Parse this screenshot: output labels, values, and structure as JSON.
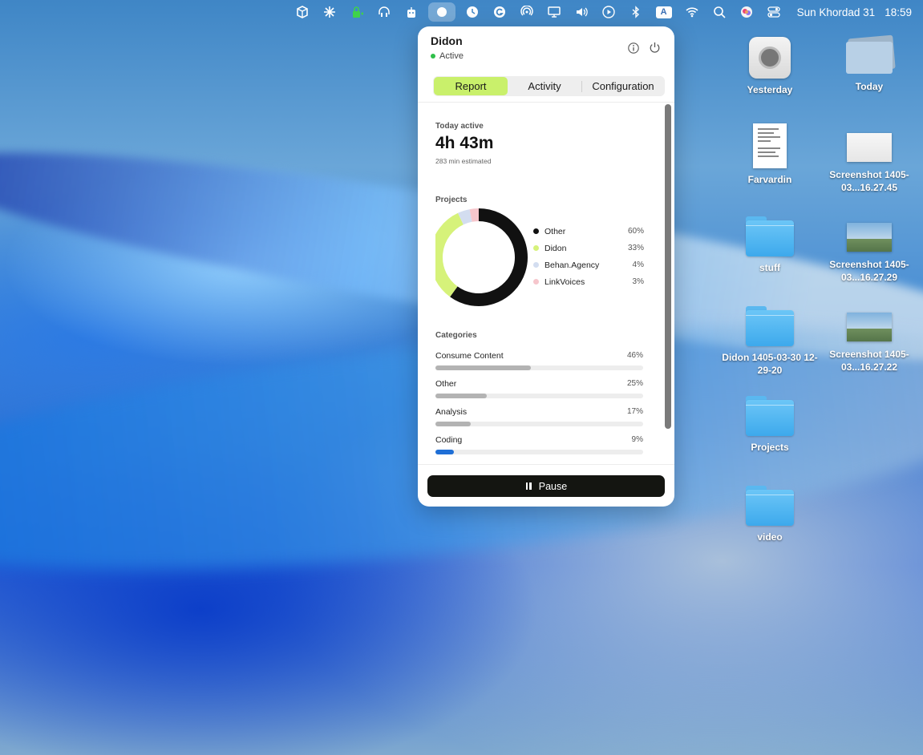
{
  "menubar": {
    "icons": [
      "box-icon",
      "sparkle-icon",
      "lock-icon",
      "headphones-icon",
      "robot-icon",
      "didon-status-icon",
      "clock-icon",
      "grammarly-icon",
      "airdrop-icon",
      "display-icon",
      "volume-icon",
      "play-icon",
      "bluetooth-icon",
      "input-source-icon",
      "wifi-icon",
      "search-icon",
      "siri-icon",
      "control-center-icon"
    ],
    "input_source_letter": "A",
    "date": "Sun Khordad 31",
    "time": "18:59"
  },
  "panel": {
    "app_name": "Didon",
    "status": "Active",
    "status_color": "#2fbf4a",
    "tabs": [
      {
        "label": "Report",
        "active": true
      },
      {
        "label": "Activity",
        "active": false
      },
      {
        "label": "Configuration",
        "active": false
      }
    ],
    "accent": "#c9f06b",
    "today": {
      "label": "Today active",
      "value": "4h 43m",
      "sub": "283 min estimated"
    },
    "projects": {
      "label": "Projects",
      "items": [
        {
          "name": "Other",
          "pct": "60%",
          "value": 60,
          "color": "#111111"
        },
        {
          "name": "Didon",
          "pct": "33%",
          "value": 33,
          "color": "#d6f27a"
        },
        {
          "name": "Behan.Agency",
          "pct": "4%",
          "value": 4,
          "color": "#d3ddf0"
        },
        {
          "name": "LinkVoices",
          "pct": "3%",
          "value": 3,
          "color": "#f6c6cc"
        }
      ]
    },
    "categories": {
      "label": "Categories",
      "items": [
        {
          "name": "Consume Content",
          "pct": "46%",
          "value": 46,
          "color": "#b3b3b3"
        },
        {
          "name": "Other",
          "pct": "25%",
          "value": 25,
          "color": "#b3b3b3"
        },
        {
          "name": "Analysis",
          "pct": "17%",
          "value": 17,
          "color": "#b3b3b3"
        },
        {
          "name": "Coding",
          "pct": "9%",
          "value": 9,
          "color": "#1f6fd6"
        }
      ]
    },
    "pause_label": "Pause"
  },
  "desktop": {
    "items": [
      {
        "label": "Yesterday",
        "kind": "disk-image"
      },
      {
        "label": "Today",
        "kind": "image-stack"
      },
      {
        "label": "Farvardin",
        "kind": "document"
      },
      {
        "label": "Screenshot 1405-03...16.27.45",
        "kind": "screenshot"
      },
      {
        "label": "stuff",
        "kind": "folder"
      },
      {
        "label": "Screenshot 1405-03...16.27.29",
        "kind": "screenshot"
      },
      {
        "label": "Didon 1405-03-30 12-29-20",
        "kind": "folder"
      },
      {
        "label": "Screenshot 1405-03...16.27.22",
        "kind": "screenshot"
      },
      {
        "label": "Projects",
        "kind": "folder"
      },
      {
        "label": "video",
        "kind": "folder"
      }
    ]
  }
}
